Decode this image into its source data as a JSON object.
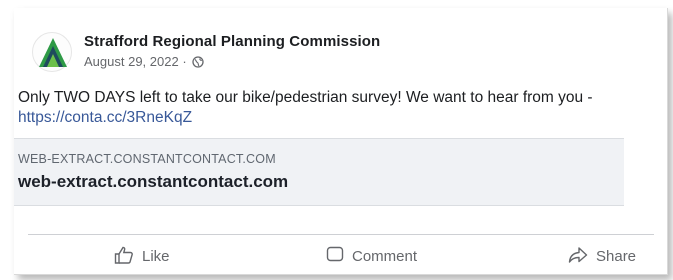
{
  "post": {
    "page_name": "Strafford Regional Planning Commission",
    "date": "August 29, 2022",
    "separator": " · ",
    "text": "Only TWO DAYS left to take our bike/pedestrian survey! We want to hear from you -",
    "link": "https://conta.cc/3RneKqZ"
  },
  "link_preview": {
    "domain_caps": "WEB-EXTRACT.CONSTANTCONTACT.COM",
    "title": "web-extract.constantcontact.com"
  },
  "actions": {
    "like": "Like",
    "comment": "Comment",
    "share": "Share"
  },
  "icons": {
    "logo": "srpc-triangle-logo",
    "privacy": "globe-icon",
    "like": "thumbs-up-icon",
    "comment": "comment-icon",
    "share": "share-icon"
  },
  "colors": {
    "link": "#385898",
    "logo_green": "#2e9a46",
    "logo_dark": "#1f4a5e"
  }
}
